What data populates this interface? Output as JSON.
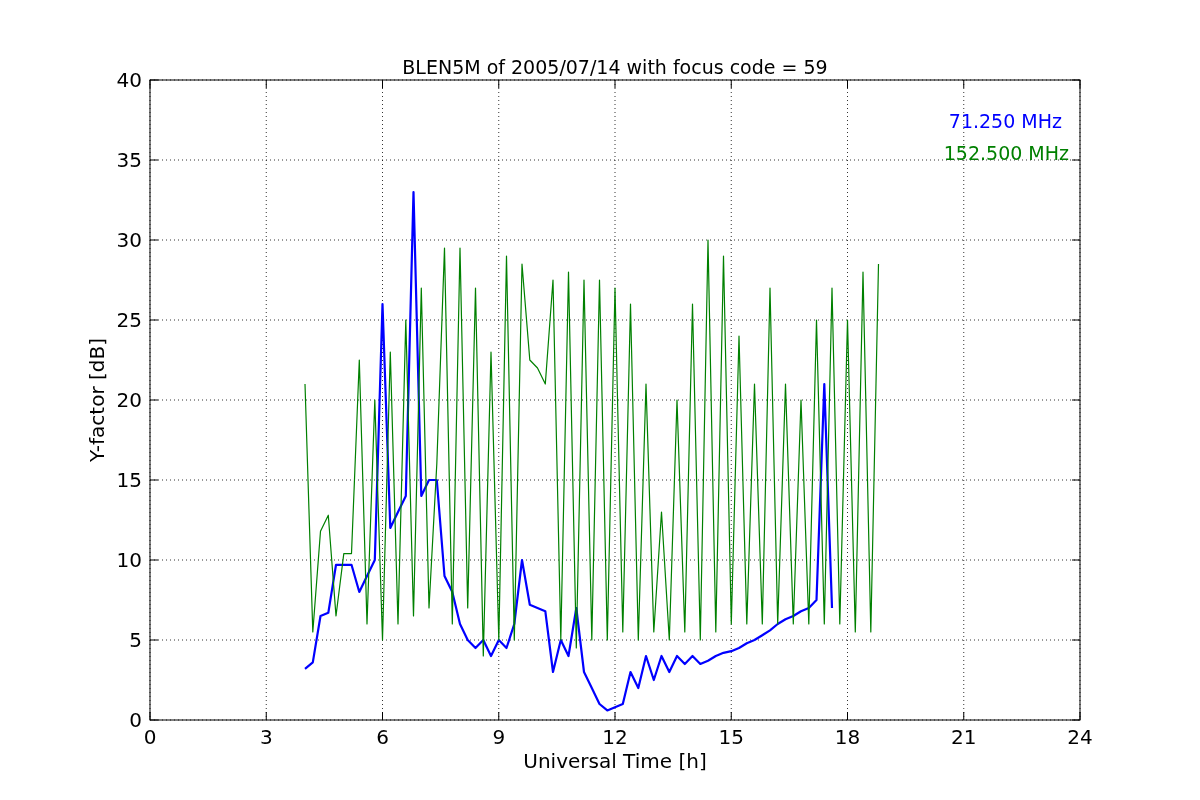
{
  "figure": {
    "chart_data": {
      "type": "line",
      "grid": true,
      "title": "BLEN5M of 2005/07/14 with focus code = 59",
      "xlabel": "Universal Time [h]",
      "ylabel": "Y-factor [dB]",
      "xlim": [
        0,
        24
      ],
      "ylim": [
        0,
        40
      ],
      "xticks": [
        0,
        3,
        6,
        9,
        12,
        15,
        18,
        21,
        24
      ],
      "yticks": [
        0,
        5,
        10,
        15,
        20,
        25,
        30,
        35,
        40
      ],
      "x": [
        4.0,
        4.2,
        4.4,
        4.6,
        4.8,
        5.0,
        5.2,
        5.4,
        5.6,
        5.8,
        6.0,
        6.2,
        6.4,
        6.6,
        6.8,
        7.0,
        7.2,
        7.4,
        7.6,
        7.8,
        8.0,
        8.2,
        8.4,
        8.6,
        8.8,
        9.0,
        9.2,
        9.4,
        9.6,
        9.8,
        10.0,
        10.2,
        10.4,
        10.6,
        10.8,
        11.0,
        11.2,
        11.4,
        11.6,
        11.8,
        12.0,
        12.2,
        12.4,
        12.6,
        12.8,
        13.0,
        13.2,
        13.4,
        13.6,
        13.8,
        14.0,
        14.2,
        14.4,
        14.6,
        14.8,
        15.0,
        15.2,
        15.4,
        15.6,
        15.8,
        16.0,
        16.2,
        16.4,
        16.6,
        16.8,
        17.0,
        17.2,
        17.4,
        17.6,
        17.8,
        18.0,
        18.2,
        18.4,
        18.6,
        18.8
      ],
      "series": [
        {
          "name": "71.250 MHz",
          "color": "#0000ff",
          "values": [
            3.2,
            3.6,
            6.5,
            6.7,
            9.7,
            9.7,
            9.7,
            8,
            9,
            10,
            26,
            12,
            13,
            14,
            33,
            14,
            15,
            15,
            9,
            8,
            6,
            5,
            4.5,
            5,
            4,
            5,
            4.5,
            6,
            10,
            7.2,
            7,
            6.8,
            3,
            5,
            4,
            7,
            3,
            2,
            1,
            0.6,
            0.8,
            1,
            3,
            2,
            4,
            2.5,
            4,
            3,
            4,
            3.5,
            4,
            3.5,
            3.7,
            4,
            4.2,
            4.3,
            4.5,
            4.8,
            5,
            5.3,
            5.6,
            6,
            6.3,
            6.5,
            6.8,
            7,
            7.5,
            21,
            7,
            null,
            null,
            null,
            null,
            null,
            null
          ]
        },
        {
          "name": "152.500 MHz",
          "color": "#008000",
          "values": [
            21,
            5.5,
            11.8,
            12.8,
            6.5,
            10.4,
            10.4,
            22.5,
            6,
            20,
            5,
            23,
            6,
            25,
            6.5,
            27,
            7,
            16,
            29.5,
            6,
            29.5,
            7,
            27,
            4,
            23,
            5,
            29,
            5,
            28.5,
            22.5,
            22,
            21,
            27.5,
            5,
            28,
            4.5,
            27.5,
            5,
            27.5,
            5,
            27,
            5.5,
            26,
            5,
            21,
            5.5,
            13,
            5,
            20,
            5.5,
            26,
            5,
            30,
            5.5,
            29,
            6,
            24,
            6,
            21,
            6,
            27,
            6,
            21,
            6,
            20,
            6,
            25,
            6,
            27,
            6,
            25,
            5.5,
            28,
            5.5,
            28.5
          ]
        }
      ]
    }
  }
}
